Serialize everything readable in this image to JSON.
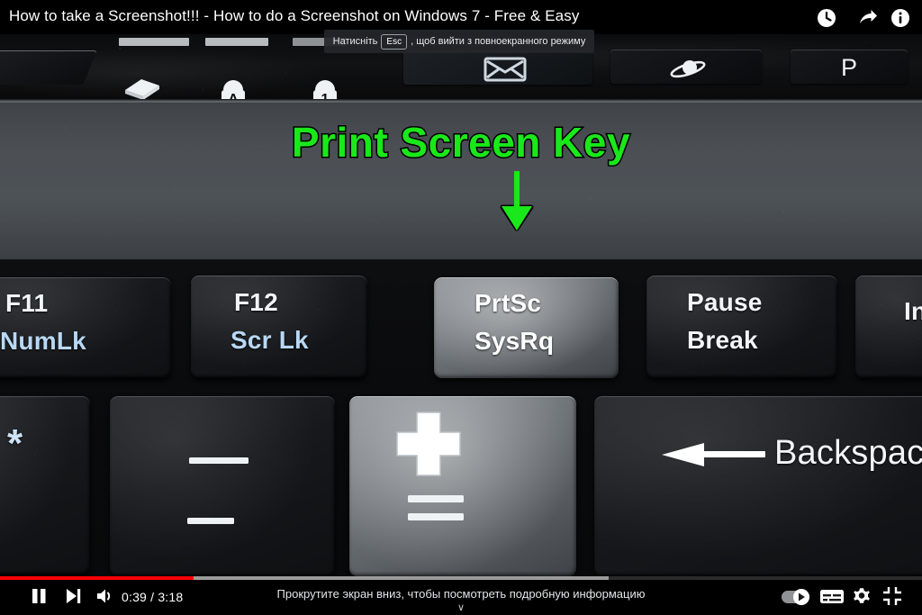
{
  "player": {
    "title": "How to take a Screenshot!!! - How to do a Screenshot on Windows 7 - Free & Easy",
    "top_icons": [
      {
        "name": "watch-later-icon",
        "label": "Watch later"
      },
      {
        "name": "share-icon",
        "label": "Share"
      },
      {
        "name": "info-icon",
        "label": "More info"
      }
    ],
    "fullscreen_tip": {
      "prefix": "Натисніть",
      "key": "Esc",
      "suffix": ", щоб вийти з повноекранного режиму"
    },
    "controls": {
      "pause_label": "Пауза",
      "next_label": "Наступне відео",
      "volume_label": "Гучність",
      "time": "0:39 / 3:18",
      "current_time": "0:39",
      "duration": "3:18",
      "autoplay_label": "Автовідтворення",
      "subtitles_label": "Субтитри",
      "settings_label": "Налаштування",
      "exit_fullscreen_label": "Вийти з повноекранного режиму"
    },
    "progress": {
      "played_percent": 21,
      "buffered_percent": 66,
      "played_color": "#ff0000",
      "buffered_color": "#9b9b9b"
    },
    "scroll_hint": {
      "text": "Прокрутите экран вниз, чтобы посмотреть подробную информацию",
      "chevron": "∨"
    }
  },
  "annotation": {
    "text": "Print Screen Key",
    "text_color": "#1ae81a",
    "outline_color": "#000000",
    "arrow": "down-arrow"
  },
  "photo": {
    "description": "Close-up photo of a laptop keyboard with the Print Screen key highlighted",
    "deck_color": "#4b4f54",
    "bezel_color": "#0d0e10",
    "indicators": [
      {
        "name": "book-indicator-icon",
        "glyph": "book"
      },
      {
        "name": "caps-lock-indicator-icon",
        "glyph": "A-lock"
      },
      {
        "name": "num-lock-indicator-icon",
        "glyph": "1-lock"
      }
    ],
    "hotkeys": [
      {
        "name": "hotkey-mail",
        "glyph": "envelope"
      },
      {
        "name": "hotkey-browser",
        "glyph": "planet"
      },
      {
        "name": "hotkey-power",
        "glyph": "P",
        "label": "P"
      }
    ],
    "function_row": [
      {
        "name": "key-f11",
        "primary": "F11",
        "secondary": "NumLk",
        "secondary_color": "#b8d8f5",
        "highlighted": false
      },
      {
        "name": "key-f12",
        "primary": "F12",
        "secondary": "Scr Lk",
        "secondary_color": "#b8d8f5",
        "highlighted": false
      },
      {
        "name": "key-print-screen",
        "primary": "PrtSc",
        "secondary": "SysRq",
        "secondary_color": "#ffffff",
        "highlighted": true
      },
      {
        "name": "key-pause-break",
        "primary": "Pause",
        "secondary": "Break",
        "secondary_color": "#ffffff",
        "highlighted": false
      },
      {
        "name": "key-insert",
        "primary": "In",
        "secondary": "",
        "secondary_color": "#ffffff",
        "highlighted": false
      }
    ],
    "number_row": [
      {
        "name": "key-asterisk",
        "primary": "*",
        "secondary": "",
        "highlighted": false
      },
      {
        "name": "key-minus-underscore",
        "primary": "—",
        "secondary": "—",
        "highlighted": false
      },
      {
        "name": "key-plus-equals",
        "primary": "+",
        "secondary": "=",
        "highlighted": true
      },
      {
        "name": "key-backspace",
        "primary": "Backspace",
        "secondary": "",
        "highlighted": false
      }
    ]
  }
}
